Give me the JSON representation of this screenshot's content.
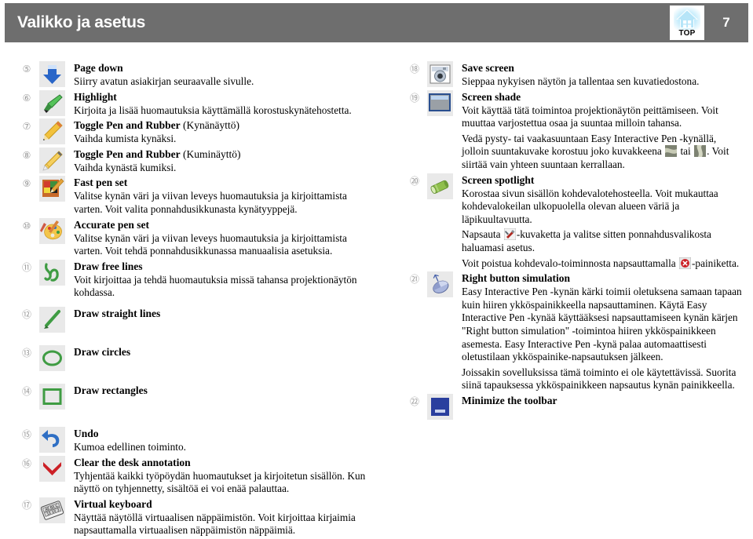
{
  "header": {
    "title": "Valikko ja asetus",
    "logo_label": "TOP",
    "logo_icon": "home-top-icon",
    "page_number": "7",
    "bar_color": "#6e6e6e"
  },
  "left_column": [
    {
      "number": "⑤",
      "icon": "page-down-arrow-icon",
      "title": "Page down",
      "title_suffix": "",
      "desc": [
        "Siirry avatun asiakirjan seuraavalle sivulle."
      ]
    },
    {
      "number": "⑥",
      "icon": "highlighter-icon",
      "title": "Highlight",
      "title_suffix": "",
      "desc": [
        "Kirjoita ja lisää huomautuksia käyttämällä korostuskynätehostetta."
      ]
    },
    {
      "number": "⑦",
      "icon": "pencil-icon",
      "title": "Toggle Pen and Rubber",
      "title_suffix": " (Kynänäyttö)",
      "desc": [
        "Vaihda kumista kynäksi."
      ]
    },
    {
      "number": "⑧",
      "icon": "pencil-eraser-icon",
      "title": "Toggle Pen and Rubber",
      "title_suffix": " (Kuminäyttö)",
      "desc": [
        "Vaihda kynästä kumiksi."
      ]
    },
    {
      "number": "⑨",
      "icon": "fast-pen-set-icon",
      "title": "Fast pen set",
      "title_suffix": "",
      "desc": [
        "Valitse kynän väri ja viivan leveys huomautuksia ja kirjoittamista varten. Voit valita ponnahdusikkunasta kynätyyppejä."
      ]
    },
    {
      "number": "⑩",
      "icon": "palette-icon",
      "title": "Accurate pen set",
      "title_suffix": "",
      "desc": [
        "Valitse kynän väri ja viivan leveys huomautuksia ja kirjoittamista varten. Voit tehdä ponnahdusikkunassa manuaalisia asetuksia."
      ]
    },
    {
      "number": "⑪",
      "icon": "free-line-icon",
      "title": "Draw free lines",
      "title_suffix": "",
      "desc": [
        "Voit kirjoittaa ja tehdä huomautuksia missä tahansa projektionäytön kohdassa."
      ]
    },
    {
      "number": "⑫",
      "icon": "straight-line-icon",
      "title": "Draw straight lines",
      "title_suffix": "",
      "desc": []
    },
    {
      "number": "⑬",
      "icon": "circle-icon",
      "title": "Draw circles",
      "title_suffix": "",
      "desc": []
    },
    {
      "number": "⑭",
      "icon": "rectangle-icon",
      "title": "Draw rectangles",
      "title_suffix": "",
      "desc": []
    },
    {
      "number": "⑮",
      "icon": "undo-arrow-icon",
      "title": "Undo",
      "title_suffix": "",
      "desc": [
        "Kumoa edellinen toiminto."
      ]
    },
    {
      "number": "⑯",
      "icon": "red-cross-icon",
      "title": "Clear the desk annotation",
      "title_suffix": "",
      "desc": [
        "Tyhjentää kaikki työpöydän huomautukset ja kirjoitetun sisällön. Kun näyttö on tyhjennetty, sisältöä ei voi enää palauttaa."
      ]
    },
    {
      "number": "⑰",
      "icon": "virtual-keyboard-icon",
      "title": "Virtual keyboard",
      "title_suffix": "",
      "desc": [
        "Näyttää näytöllä virtuaalisen näppäimistön. Voit kirjoittaa kirjaimia napsauttamalla virtuaalisen näppäimistön näppäimiä."
      ]
    }
  ],
  "right_column": [
    {
      "number": "⑱",
      "icon": "camera-save-screen-icon",
      "title": "Save screen",
      "title_suffix": "",
      "desc": [
        "Sieppaa nykyisen näytön ja tallentaa sen kuvatiedostona."
      ]
    },
    {
      "number": "⑲",
      "icon": "screen-shade-icon",
      "title": "Screen shade",
      "title_suffix": "",
      "desc": [
        "Voit käyttää tätä toimintoa projektionäytön peittämiseen. Voit muuttaa varjostettua osaa ja suuntaa milloin tahansa."
      ],
      "rich_paragraph": {
        "before": "Vedä pysty- tai vaakasuuntaan Easy Interactive Pen -kynällä, jolloin suuntakuvake korostuu joko kuvakkeena ",
        "icon1": "shade-horizontal-icon",
        "middle": " tai ",
        "icon2": "shade-vertical-icon",
        "after": ". Voit siirtää vain yhteen suuntaan kerrallaan."
      }
    },
    {
      "number": "⑳",
      "icon": "spotlight-icon",
      "title": "Screen spotlight",
      "title_suffix": "",
      "desc": [
        "Korostaa sivun sisällön kohdevalotehosteella. Voit mukauttaa kohdevalokeilan ulkopuolella olevan alueen väriä ja läpikuultavuutta."
      ],
      "rich_paragraph2": {
        "before": "Napsauta ",
        "icon1": "tools-wrench-icon",
        "after": "-kuvaketta ja valitse sitten ponnahdusvalikosta haluamasi asetus."
      },
      "rich_paragraph3": {
        "before": "Voit poistua kohdevalo-toiminnosta napsauttamalla ",
        "icon1": "red-close-circle-icon",
        "after": "-painiketta."
      }
    },
    {
      "number": "㉑",
      "icon": "mouse-right-button-icon",
      "title": "Right button simulation",
      "title_suffix": "",
      "desc": [
        "Easy Interactive Pen -kynän kärki toimii oletuksena samaan tapaan kuin hiiren ykköspainikkeella napsauttaminen. Käytä Easy Interactive Pen -kynää käyttääksesi napsauttamiseen kynän kärjen \"Right button simulation\" -toimintoa hiiren ykköspainikkeen asemesta. Easy Interactive Pen -kynä palaa automaattisesti oletustilaan ykköspainike-napsautuksen jälkeen.",
        "Joissakin sovelluksissa tämä toiminto ei ole käytettävissä. Suorita siinä tapauksessa ykköspainikkeen napsautus kynän painikkeella."
      ]
    },
    {
      "number": "㉒",
      "icon": "minimize-toolbar-icon",
      "title": "Minimize the toolbar",
      "title_suffix": "",
      "desc": []
    }
  ]
}
